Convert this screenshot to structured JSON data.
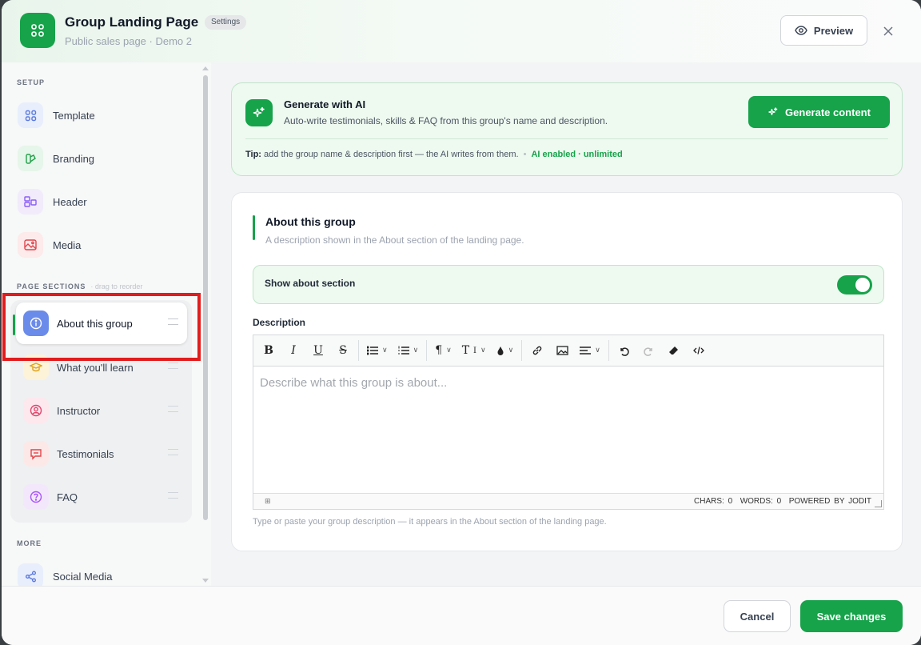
{
  "header": {
    "title": "Group Landing Page",
    "badge": "Settings",
    "subtitle": "Public sales page · Demo 2",
    "preview_label": "Preview"
  },
  "sidebar": {
    "setup_label": "SETUP",
    "setup_items": [
      {
        "label": "Template",
        "icon": "grid-icon",
        "color": "#e8eefc"
      },
      {
        "label": "Branding",
        "icon": "palette-icon",
        "color": "#e6f6ea"
      },
      {
        "label": "Header",
        "icon": "layout-icon",
        "color": "#f1ebfb"
      },
      {
        "label": "Media",
        "icon": "image-icon",
        "color": "#fdeaea"
      }
    ],
    "sections_label": "PAGE SECTIONS",
    "sections_hint": "drag to reorder",
    "sections": [
      {
        "label": "About this group",
        "icon": "info-icon",
        "active": true
      },
      {
        "label": "What you'll learn",
        "icon": "graduation-cap-icon"
      },
      {
        "label": "Instructor",
        "icon": "user-icon"
      },
      {
        "label": "Testimonials",
        "icon": "chat-icon"
      },
      {
        "label": "FAQ",
        "icon": "question-icon"
      }
    ],
    "more_label": "MORE",
    "more_items": [
      {
        "label": "Social Media",
        "icon": "share-icon"
      }
    ]
  },
  "ai": {
    "title": "Generate with AI",
    "description": "Auto-write testimonials, skills & FAQ from this group's name and description.",
    "button": "Generate content",
    "tip_label": "Tip:",
    "tip_text": "add the group name & description first — the AI writes from them.",
    "status": "AI enabled · unlimited"
  },
  "about": {
    "title": "About this group",
    "subtitle": "A description shown in the About section of the landing page.",
    "toggle_label": "Show about section",
    "toggle_on": true,
    "description_label": "Description",
    "editor_placeholder": "Describe what this group is about...",
    "status_chars": "CHARS: 0",
    "status_words": "WORDS: 0",
    "status_powered": "POWERED BY JODIT",
    "status_left": "⊞",
    "hint": "Type or paste your group description — it appears in the About section of the landing page."
  },
  "footer": {
    "cancel": "Cancel",
    "save": "Save changes"
  },
  "colors": {
    "accent": "#16a34a",
    "highlight": "#e11d1d"
  }
}
